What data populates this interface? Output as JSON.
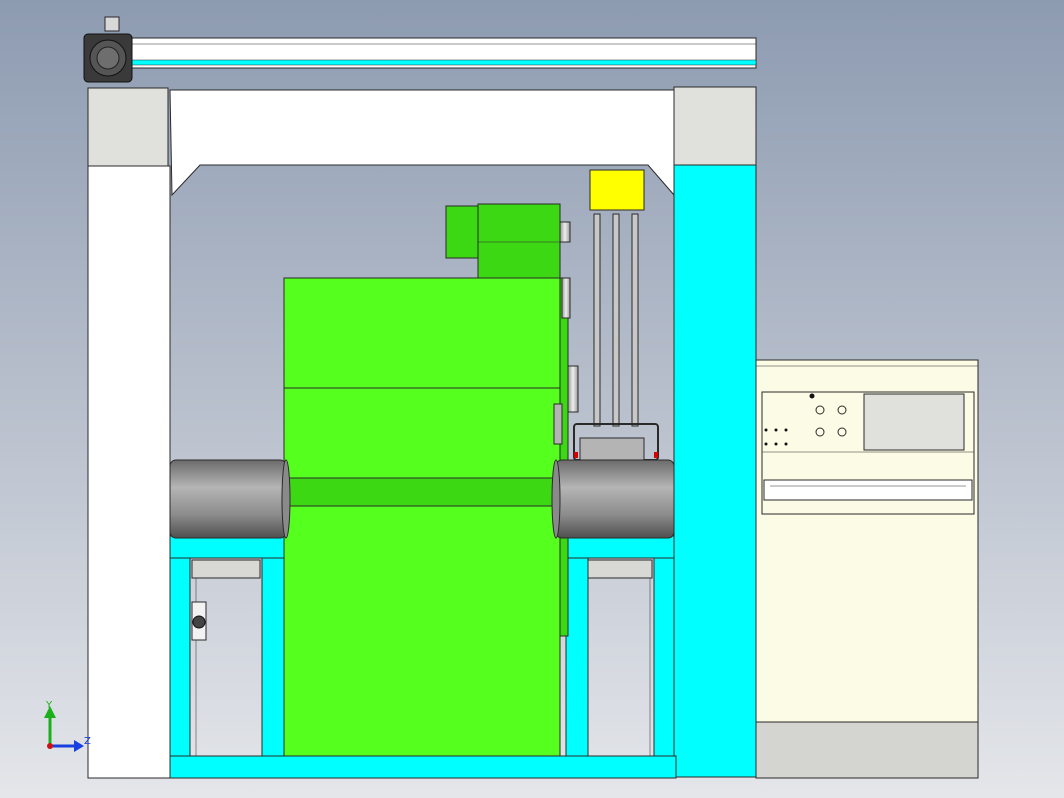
{
  "viewport": {
    "background_top": "#8d9bb1",
    "background_bottom": "#e4e6ea"
  },
  "colors": {
    "frame_white": "#ffffff",
    "frame_cyan": "#00ffff",
    "frame_grey": "#e0e0dc",
    "body_green": "#55ff1e",
    "body_green_dark": "#3dd814",
    "pipe_grey": "#9a9a9a",
    "cabinet": "#fbfbe6",
    "panel_grey": "#e0e0dc",
    "yellow_box": "#ffff00",
    "outline": "#2a2a2a"
  },
  "model_parts": [
    "top-beam",
    "servo-motor",
    "left-column",
    "right-column",
    "base-frame",
    "green-machine-body",
    "green-motor-box",
    "left-pipe",
    "right-pipe",
    "yellow-sensor",
    "rod-assembly",
    "control-cabinet",
    "control-panel",
    "display-screen"
  ],
  "triad": {
    "icon": "coordinate-triad-icon",
    "y_label": "Y",
    "z_label": "Z"
  }
}
